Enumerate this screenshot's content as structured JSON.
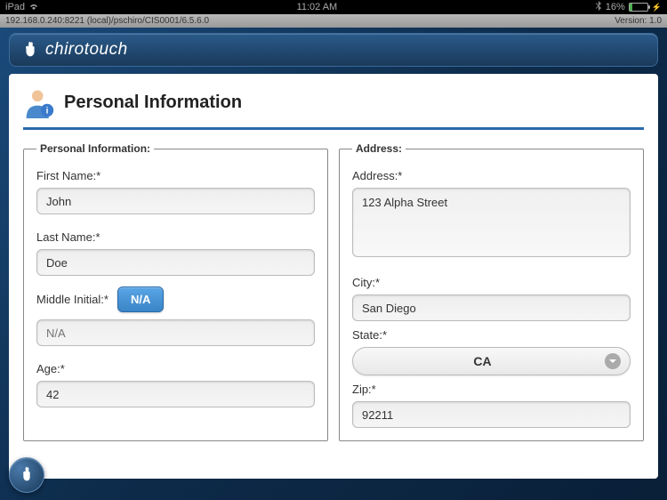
{
  "status": {
    "carrier": "iPad",
    "time": "11:02 AM",
    "battery_pct": "16%"
  },
  "info_bar": {
    "server": "192.168.0.240:8221 (local)/pschiro/CIS0001/6.5.6.0",
    "version": "Version: 1.0"
  },
  "brand": {
    "name_a": "chiro",
    "name_b": "touch"
  },
  "page": {
    "title": "Personal Information"
  },
  "personal": {
    "legend": "Personal Information:",
    "first_name_label": "First Name:*",
    "first_name": "John",
    "last_name_label": "Last Name:*",
    "last_name": "Doe",
    "middle_initial_label": "Middle Initial:*",
    "na_button": "N/A",
    "middle_initial_placeholder": "N/A",
    "age_label": "Age:*",
    "age": "42"
  },
  "address": {
    "legend": "Address:",
    "address_label": "Address:*",
    "address": "123 Alpha Street",
    "city_label": "City:*",
    "city": "San Diego",
    "state_label": "State:*",
    "state": "CA",
    "zip_label": "Zip:*",
    "zip": "92211"
  }
}
